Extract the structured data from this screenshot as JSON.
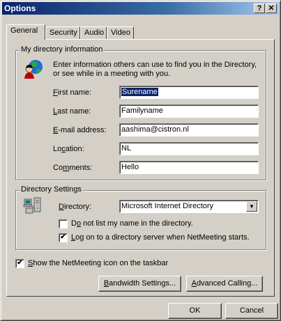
{
  "window": {
    "title": "Options",
    "help_label": "?",
    "close_label": "✕"
  },
  "tabs": [
    {
      "label": "General",
      "active": true
    },
    {
      "label": "Security"
    },
    {
      "label": "Audio"
    },
    {
      "label": "Video"
    }
  ],
  "my_directory": {
    "group_label": "My directory information",
    "intro_line1": "Enter information others can use to find you in the Directory,",
    "intro_line2": "or see while in a meeting with you.",
    "first_name": {
      "label_pre": "",
      "label_key": "F",
      "label_post": "irst name:",
      "value": "Surename"
    },
    "last_name": {
      "label_pre": "",
      "label_key": "L",
      "label_post": "ast name:",
      "value": "Familyname"
    },
    "email": {
      "label_pre": "",
      "label_key": "E",
      "label_post": "-mail address:",
      "value": "aashima@cistron.nl"
    },
    "location": {
      "label_pre": "Lo",
      "label_key": "c",
      "label_post": "ation:",
      "value": "NL"
    },
    "comments": {
      "label_pre": "Co",
      "label_key": "m",
      "label_post": "ments:",
      "value": "Hello"
    }
  },
  "directory_settings": {
    "group_label": "Directory Settings",
    "directory_label_key": "D",
    "directory_label_post": "irectory:",
    "directory_value": "Microsoft Internet Directory",
    "do_not_list": {
      "pre": "D",
      "key": "o",
      "post": " not list my name in the directory.",
      "checked": false
    },
    "log_on": {
      "pre": "",
      "key": "L",
      "post": "og on to a directory server when NetMeeting starts.",
      "checked": true
    }
  },
  "taskbar_icon": {
    "pre": "",
    "key": "S",
    "post": "how the NetMeeting icon on the taskbar",
    "checked": true
  },
  "buttons": {
    "bandwidth_key": "B",
    "bandwidth_post": "andwidth Settings...",
    "advanced_key": "A",
    "advanced_post": "dvanced Calling...",
    "ok": "OK",
    "cancel": "Cancel"
  },
  "check_mark": "✔"
}
